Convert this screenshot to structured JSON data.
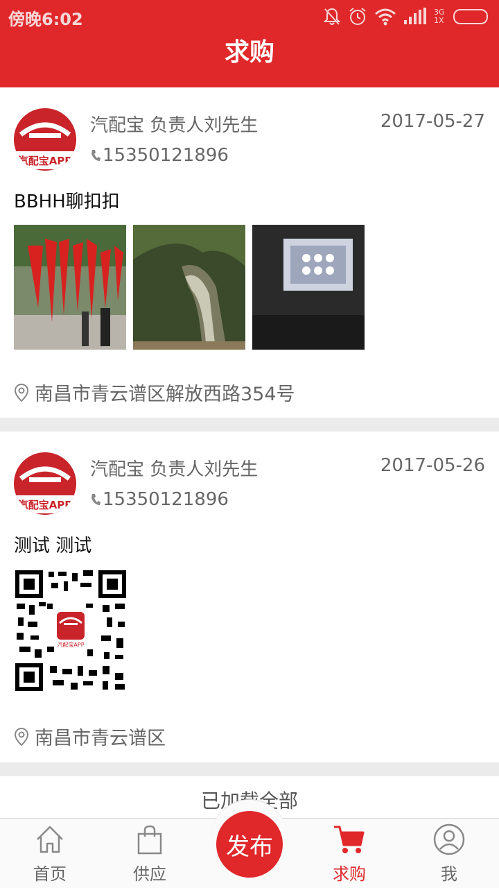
{
  "status_bar": {
    "time": "傍晚6:02",
    "network": "3G\n1X"
  },
  "header": {
    "title": "求购"
  },
  "posts": [
    {
      "name": "汽配宝 负责人刘先生",
      "date": "2017-05-27",
      "phone": "15350121896",
      "description": "BBHH聊扣扣",
      "location": "南昌市青云谱区解放西路354号",
      "avatar_text": "汽配宝APP"
    },
    {
      "name": "汽配宝 负责人刘先生",
      "date": "2017-05-26",
      "phone": "15350121896",
      "description": "测试 测试",
      "location": "南昌市青云谱区",
      "avatar_text": "汽配宝APP",
      "qr_text": "汽配宝APP"
    }
  ],
  "load_status": "已加载全部",
  "nav": {
    "home": "首页",
    "supply": "供应",
    "publish": "发布",
    "purchase": "求购",
    "me": "我"
  },
  "colors": {
    "brand": "#e0282b",
    "text": "#666666"
  }
}
